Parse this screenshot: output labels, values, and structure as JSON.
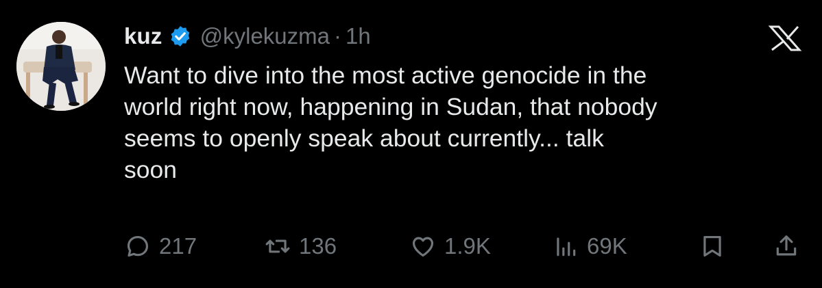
{
  "author": {
    "name": "kuz",
    "handle": "@kylekuzma",
    "separator": "·",
    "time": "1h"
  },
  "tweet": {
    "lines": [
      "Want to dive into the most active genocide in the",
      "world right now, happening in Sudan, that nobody",
      "seems to openly speak about currently... talk",
      "soon"
    ]
  },
  "actions": {
    "replies": "217",
    "retweets": "136",
    "likes": "1.9K",
    "views": "69K"
  },
  "icons": {
    "verified": "verified-badge-icon",
    "brand": "x-logo-icon",
    "reply": "reply-icon",
    "retweet": "retweet-icon",
    "like": "heart-icon",
    "views": "views-bar-chart-icon",
    "bookmark": "bookmark-icon",
    "share": "share-icon"
  },
  "colors": {
    "background": "#000000",
    "text": "#e7e9ea",
    "muted": "#71767b",
    "verified": "#1d9bf0"
  }
}
